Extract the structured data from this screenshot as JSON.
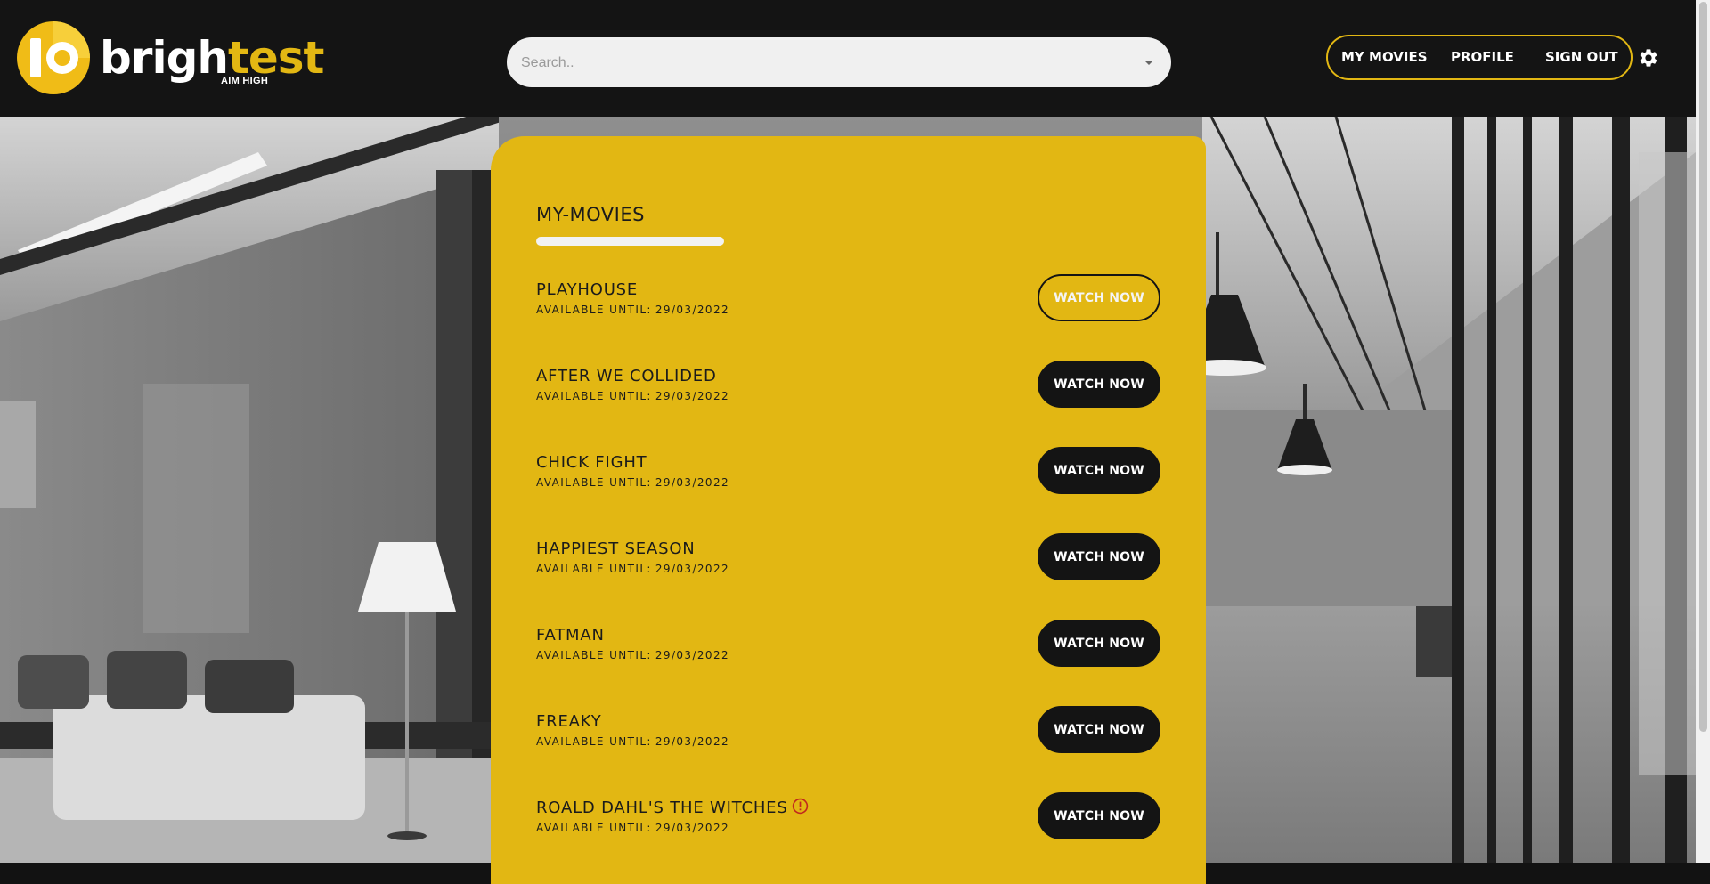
{
  "header": {
    "logo": {
      "word_white": "brigh",
      "word_yellow": "test",
      "tagline": "AIM HIGH"
    },
    "search": {
      "placeholder": "Search.."
    },
    "nav": {
      "my_movies": "MY MOVIES",
      "profile": "PROFILE",
      "sign_out": "SIGN OUT"
    },
    "settings_icon": "gear-icon"
  },
  "main": {
    "title": "MY-MOVIES",
    "available_label": "AVAILABLE UNTIL:",
    "watch_label": "WATCH NOW",
    "movies": [
      {
        "title": "PLAYHOUSE",
        "available_until": "29/03/2022"
      },
      {
        "title": "AFTER WE COLLIDED",
        "available_until": "29/03/2022"
      },
      {
        "title": "CHICK FIGHT",
        "available_until": "29/03/2022"
      },
      {
        "title": "HAPPIEST SEASON",
        "available_until": "29/03/2022"
      },
      {
        "title": "FATMAN",
        "available_until": "29/03/2022"
      },
      {
        "title": "FREAKY",
        "available_until": "29/03/2022"
      },
      {
        "title": "ROALD DAHL'S THE WITCHES",
        "available_until": "29/03/2022"
      }
    ]
  },
  "colors": {
    "accent": "#e2b713",
    "header_bg": "#141414",
    "button_bg": "#141414",
    "alert": "#c0281e"
  }
}
